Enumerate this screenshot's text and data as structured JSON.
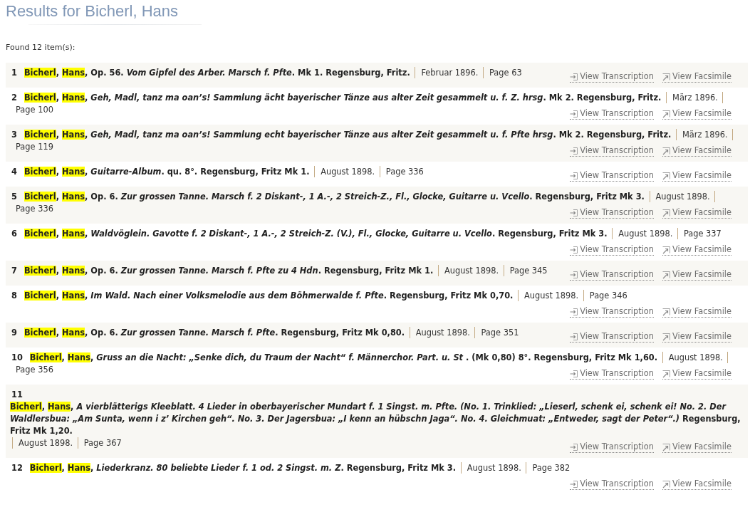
{
  "page_title": "Results for Bicherl, Hans",
  "summary": "Found 12 item(s):",
  "results": [
    {
      "number": "1",
      "kind": "inline",
      "title": [
        {
          "text": "Bicherl",
          "highlighted": true
        },
        {
          "text": ", ",
          "highlighted": false
        },
        {
          "text": "Hans",
          "highlighted": true
        },
        {
          "text": ", Op. 56. *Vom Gipfel des Arber. Marsch f. Pfte*. Mk 1. Regensburg, Fritz.",
          "highlighted": false
        }
      ],
      "date": "Februar 1896.",
      "page": "Page 63",
      "links": [
        {
          "label": "View Transcription",
          "kind": "transcription"
        },
        {
          "label": "View Facsimile",
          "kind": "facsimile"
        }
      ]
    },
    {
      "number": "2",
      "kind": "inline",
      "title": [
        {
          "text": "Bicherl",
          "highlighted": true
        },
        {
          "text": ", ",
          "highlighted": false
        },
        {
          "text": "Hans",
          "highlighted": true
        },
        {
          "text": ", *Geh, Madl, tanz ma oan’s! Sammlung ächt bayerischer Tänze aus alter Zeit gesammelt u. f. Z. hrsg*. Mk 2. Regensburg, Fritz.",
          "highlighted": false
        }
      ],
      "date": "März 1896.",
      "page": "Page 100",
      "links": [
        {
          "label": "View Transcription",
          "kind": "transcription"
        },
        {
          "label": "View Facsimile",
          "kind": "facsimile"
        }
      ]
    },
    {
      "number": "3",
      "kind": "inline",
      "title": [
        {
          "text": "Bicherl",
          "highlighted": true
        },
        {
          "text": ", ",
          "highlighted": false
        },
        {
          "text": "Hans",
          "highlighted": true
        },
        {
          "text": ", *Geh, Madl, tanz ma oan’s! Sammlung echt bayerischer Tänze aus alter Zeit gesammelt u. f. Pfte hrsg*. Mk 2. Regensburg, Fritz.",
          "highlighted": false
        }
      ],
      "date": "März 1896.",
      "page": "Page 119",
      "links": [
        {
          "label": "View Transcription",
          "kind": "transcription"
        },
        {
          "label": "View Facsimile",
          "kind": "facsimile"
        }
      ]
    },
    {
      "number": "4",
      "kind": "inline",
      "title": [
        {
          "text": "Bicherl",
          "highlighted": true
        },
        {
          "text": ", ",
          "highlighted": false
        },
        {
          "text": "Hans",
          "highlighted": true
        },
        {
          "text": ", *Guitarre-Album*. qu. 8°. Regensburg, Fritz Mk 1.",
          "highlighted": false
        }
      ],
      "date": "August 1898.",
      "page": "Page 336",
      "links": [
        {
          "label": "View Transcription",
          "kind": "transcription"
        },
        {
          "label": "View Facsimile",
          "kind": "facsimile"
        }
      ]
    },
    {
      "number": "5",
      "kind": "inline",
      "title": [
        {
          "text": "Bicherl",
          "highlighted": true
        },
        {
          "text": ", ",
          "highlighted": false
        },
        {
          "text": "Hans",
          "highlighted": true
        },
        {
          "text": ", Op. 6. *Zur grossen Tanne. Marsch f. 2 Diskant-, 1 A.-, 2 Streich-Z., Fl., Glocke, Guitarre u. Vcello*. Regensburg, Fritz Mk 3.",
          "highlighted": false
        }
      ],
      "date": "August 1898.",
      "page": "Page 336",
      "links": [
        {
          "label": "View Transcription",
          "kind": "transcription"
        },
        {
          "label": "View Facsimile",
          "kind": "facsimile"
        }
      ]
    },
    {
      "number": "6",
      "kind": "inline",
      "title": [
        {
          "text": "Bicherl",
          "highlighted": true
        },
        {
          "text": ", ",
          "highlighted": false
        },
        {
          "text": "Hans",
          "highlighted": true
        },
        {
          "text": ", *Waldvöglein. Gavotte f. 2 Diskant-, 1 A.-, 2 Streich-Z. (V.), Fl., Glocke, Guitarre u. Vcello*. Regensburg, Fritz Mk 3.",
          "highlighted": false
        }
      ],
      "date": "August 1898.",
      "page": "Page 337",
      "links": [
        {
          "label": "View Transcription",
          "kind": "transcription"
        },
        {
          "label": "View Facsimile",
          "kind": "facsimile"
        }
      ]
    },
    {
      "number": "7",
      "kind": "inline",
      "title": [
        {
          "text": "Bicherl",
          "highlighted": true
        },
        {
          "text": ", ",
          "highlighted": false
        },
        {
          "text": "Hans",
          "highlighted": true
        },
        {
          "text": ", Op. 6. *Zur grossen Tanne. Marsch f. Pfte zu 4 Hdn*. Regensburg, Fritz Mk 1.",
          "highlighted": false
        }
      ],
      "date": "August 1898.",
      "page": "Page 345",
      "links": [
        {
          "label": "View Transcription",
          "kind": "transcription"
        },
        {
          "label": "View Facsimile",
          "kind": "facsimile"
        }
      ]
    },
    {
      "number": "8",
      "kind": "inline",
      "title": [
        {
          "text": "Bicherl",
          "highlighted": true
        },
        {
          "text": ", ",
          "highlighted": false
        },
        {
          "text": "Hans",
          "highlighted": true
        },
        {
          "text": ", *Im Wald. Nach einer Volksmelodie aus dem Böhmerwalde f. Pfte*. Regensburg, Fritz Mk 0,70.",
          "highlighted": false
        }
      ],
      "date": "August 1898.",
      "page": "Page 346",
      "links": [
        {
          "label": "View Transcription",
          "kind": "transcription"
        },
        {
          "label": "View Facsimile",
          "kind": "facsimile"
        }
      ]
    },
    {
      "number": "9",
      "kind": "inline",
      "title": [
        {
          "text": "Bicherl",
          "highlighted": true
        },
        {
          "text": ", ",
          "highlighted": false
        },
        {
          "text": "Hans",
          "highlighted": true
        },
        {
          "text": ", Op. 6. *Zur grossen Tanne. Marsch f. Pfte*. Regensburg, Fritz Mk 0,80.",
          "highlighted": false
        }
      ],
      "date": "August 1898.",
      "page": "Page 351",
      "links": [
        {
          "label": "View Transcription",
          "kind": "transcription"
        },
        {
          "label": "View Facsimile",
          "kind": "facsimile"
        }
      ]
    },
    {
      "number": "10",
      "kind": "inline",
      "title": [
        {
          "text": "Bicherl",
          "highlighted": true
        },
        {
          "text": ", ",
          "highlighted": false
        },
        {
          "text": "Hans",
          "highlighted": true
        },
        {
          "text": ", *Gruss an die Nacht: „Senke dich, du Traum der Nacht“ f. Männerchor. Part. u. St* . (Mk 0,80) 8°. Regensburg, Fritz Mk 1,60.",
          "highlighted": false
        }
      ],
      "date": "August 1898.",
      "page": "Page 356",
      "links": [
        {
          "label": "View Transcription",
          "kind": "transcription"
        },
        {
          "label": "View Facsimile",
          "kind": "facsimile"
        }
      ]
    },
    {
      "number": "11",
      "kind": "stacked",
      "title": [
        {
          "text": "Bicherl",
          "highlighted": true
        },
        {
          "text": ", ",
          "highlighted": false
        },
        {
          "text": "Hans",
          "highlighted": true
        },
        {
          "text": ", *A vierblätterigs Kleeblatt. 4 Lieder in oberbayerischer Mundart f. 1 Singst. m. Pfte. (No. 1. Trinklied: „Lieserl, schenk ei, schenk ei! No. 2. Der Waldlersbua: „Am Sunta, wenn i z’ Kirchen geh“. No. 3. Der Jagersbua: „I kenn an hübschn Jaga“. No. 4. Gleichmuat: „Entweder, sagt der Peter“.)* Regensburg, Fritz Mk 1,20.",
          "highlighted": false
        }
      ],
      "date": "August 1898.",
      "page": "Page 367",
      "links": [
        {
          "label": "View Transcription",
          "kind": "transcription"
        },
        {
          "label": "View Facsimile",
          "kind": "facsimile"
        }
      ]
    },
    {
      "number": "12",
      "kind": "inline",
      "title": [
        {
          "text": "Bicherl",
          "highlighted": true
        },
        {
          "text": ", ",
          "highlighted": false
        },
        {
          "text": "Hans",
          "highlighted": true
        },
        {
          "text": ", *Liederkranz. 80 beliebte Lieder f. 1 od. 2 Singst. m. Z*. Regensburg, Fritz Mk 3.",
          "highlighted": false
        }
      ],
      "date": "August 1898.",
      "page": "Page 382",
      "links": [
        {
          "label": "View Transcription",
          "kind": "transcription"
        },
        {
          "label": "View Facsimile",
          "kind": "facsimile"
        }
      ]
    }
  ]
}
